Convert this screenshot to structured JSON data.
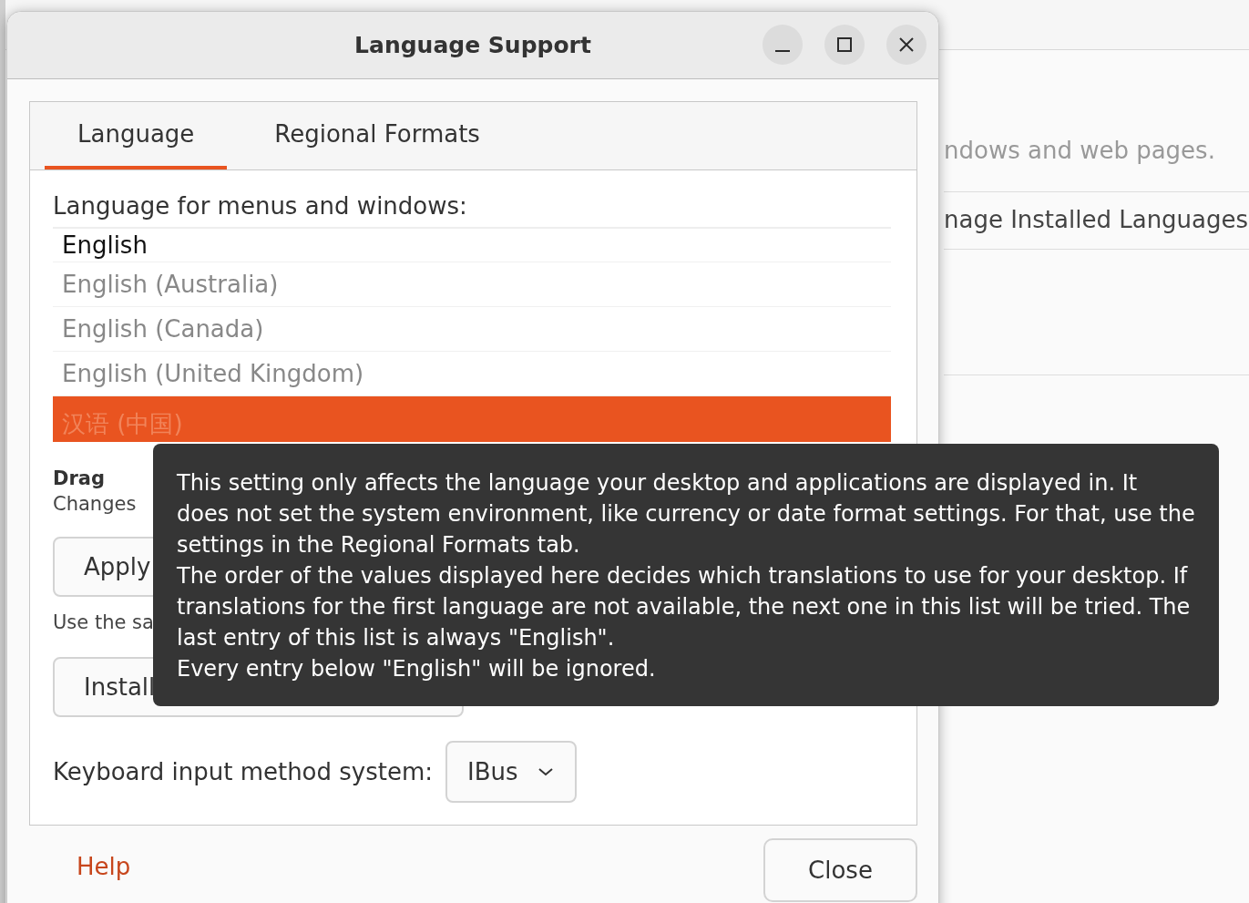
{
  "background_window": {
    "description": "ndows and web pages.",
    "manage_button": "nage Installed Languages"
  },
  "dialog": {
    "title": "Language Support",
    "tabs": [
      {
        "label": "Language",
        "selected": true
      },
      {
        "label": "Regional Formats",
        "selected": false
      }
    ],
    "language_label": "Language for menus and windows:",
    "languages": [
      {
        "name": "English",
        "selected": false,
        "primary": true
      },
      {
        "name": "English (Australia)",
        "selected": false,
        "primary": false
      },
      {
        "name": "English (Canada)",
        "selected": false,
        "primary": false
      },
      {
        "name": "English (United Kingdom)",
        "selected": false,
        "primary": false
      },
      {
        "name": "汉语 (中国)",
        "selected": true,
        "primary": false
      }
    ],
    "drag_hint": "Drag",
    "changes_note": "Changes",
    "apply_button": "Apply",
    "login_note": "Use the sa",
    "install_button": "Install",
    "keyboard_label": "Keyboard input method system:",
    "input_method": "IBus",
    "help_link": "Help",
    "close_button": "Close"
  },
  "tooltip": {
    "paragraphs": [
      "This setting only affects the language your desktop and applications are displayed in. It does not set the system environment, like currency or date format settings. For that, use the settings in the Regional Formats tab.",
      "The order of the values displayed here decides which translations to use for your desktop. If translations for the first language are not available, the next one in this list will be tried. The last entry of this list is always \"English\".",
      "Every entry below \"English\" will be ignored."
    ]
  }
}
